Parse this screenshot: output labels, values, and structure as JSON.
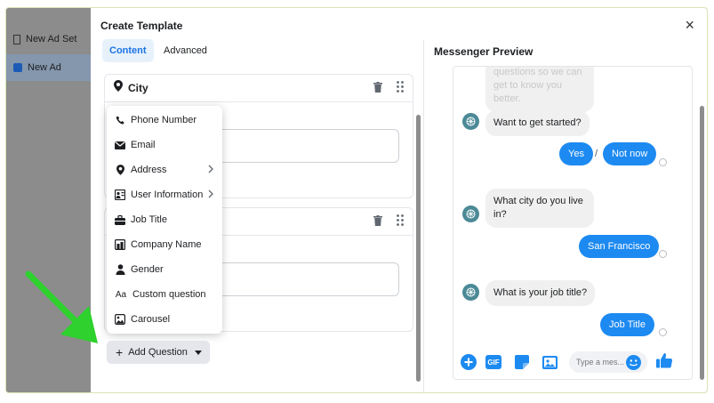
{
  "sidebar": {
    "items": [
      {
        "label": "New Ad Set",
        "icon": "ad-set-icon"
      },
      {
        "label": "New Ad",
        "icon": "ad-icon"
      }
    ]
  },
  "modal": {
    "title": "Create Template",
    "close": "×",
    "tabs": [
      {
        "label": "Content",
        "active": true
      },
      {
        "label": "Advanced",
        "active": false
      }
    ]
  },
  "questions": [
    {
      "title": "City"
    },
    {
      "title": ""
    }
  ],
  "menu": {
    "items": [
      {
        "label": "Phone Number",
        "icon": "phone-icon"
      },
      {
        "label": "Email",
        "icon": "email-icon"
      },
      {
        "label": "Address",
        "icon": "location-pin-icon",
        "submenu": true
      },
      {
        "label": "User Information",
        "icon": "user-info-icon",
        "submenu": true
      },
      {
        "label": "Job Title",
        "icon": "briefcase-icon"
      },
      {
        "label": "Company Name",
        "icon": "building-icon"
      },
      {
        "label": "Gender",
        "icon": "person-icon"
      },
      {
        "label": "Custom question",
        "icon": "text-icon"
      },
      {
        "label": "Carousel",
        "icon": "carousel-icon"
      }
    ],
    "custom_glyph": "Aa"
  },
  "add_question": {
    "label": "Add Question",
    "plus": "+"
  },
  "preview": {
    "title": "Messenger Preview",
    "messages": {
      "faded_lines": [
        "questions so we can",
        "get to know you",
        "better."
      ],
      "get_started": "Want to get started?",
      "yes": "Yes",
      "separator": "/",
      "not_now": "Not now",
      "city_q": "What city do you live in?",
      "city_a": "San Francisco",
      "job_q": "What is your job title?",
      "job_a": "Job Title"
    },
    "composer": {
      "placeholder": "Type a mes...",
      "gif": "GIF"
    }
  },
  "colors": {
    "accent": "#1b74e4",
    "bubble_out": "#1d8af1",
    "avatar": "#4b8a96"
  }
}
